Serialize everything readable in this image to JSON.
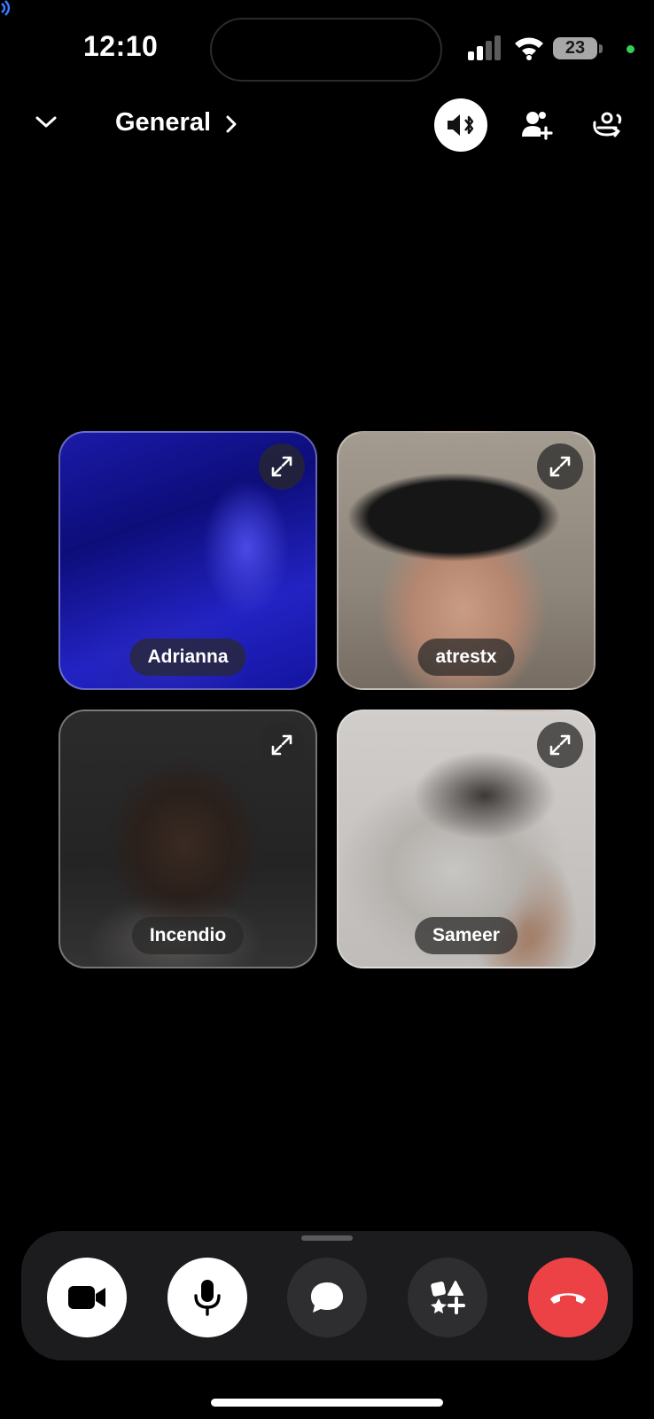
{
  "status_bar": {
    "time": "12:10",
    "battery_level": "23",
    "signal_bars": 2,
    "privacy_indicator_color": "#30d158"
  },
  "header": {
    "channel_name": "General",
    "icons": [
      "chevron-down-icon",
      "chevron-right-icon",
      "speaker-bluetooth-icon",
      "add-person-icon",
      "switch-camera-icon"
    ]
  },
  "participants": [
    {
      "name": "Adrianna"
    },
    {
      "name": "atrestx"
    },
    {
      "name": "Incendio"
    },
    {
      "name": "Sameer"
    }
  ],
  "controls": {
    "items": [
      "camera-icon",
      "microphone-icon",
      "chat-bubble-icon",
      "activities-icon",
      "hang-up-icon"
    ],
    "end_call_color": "#ed4245"
  }
}
